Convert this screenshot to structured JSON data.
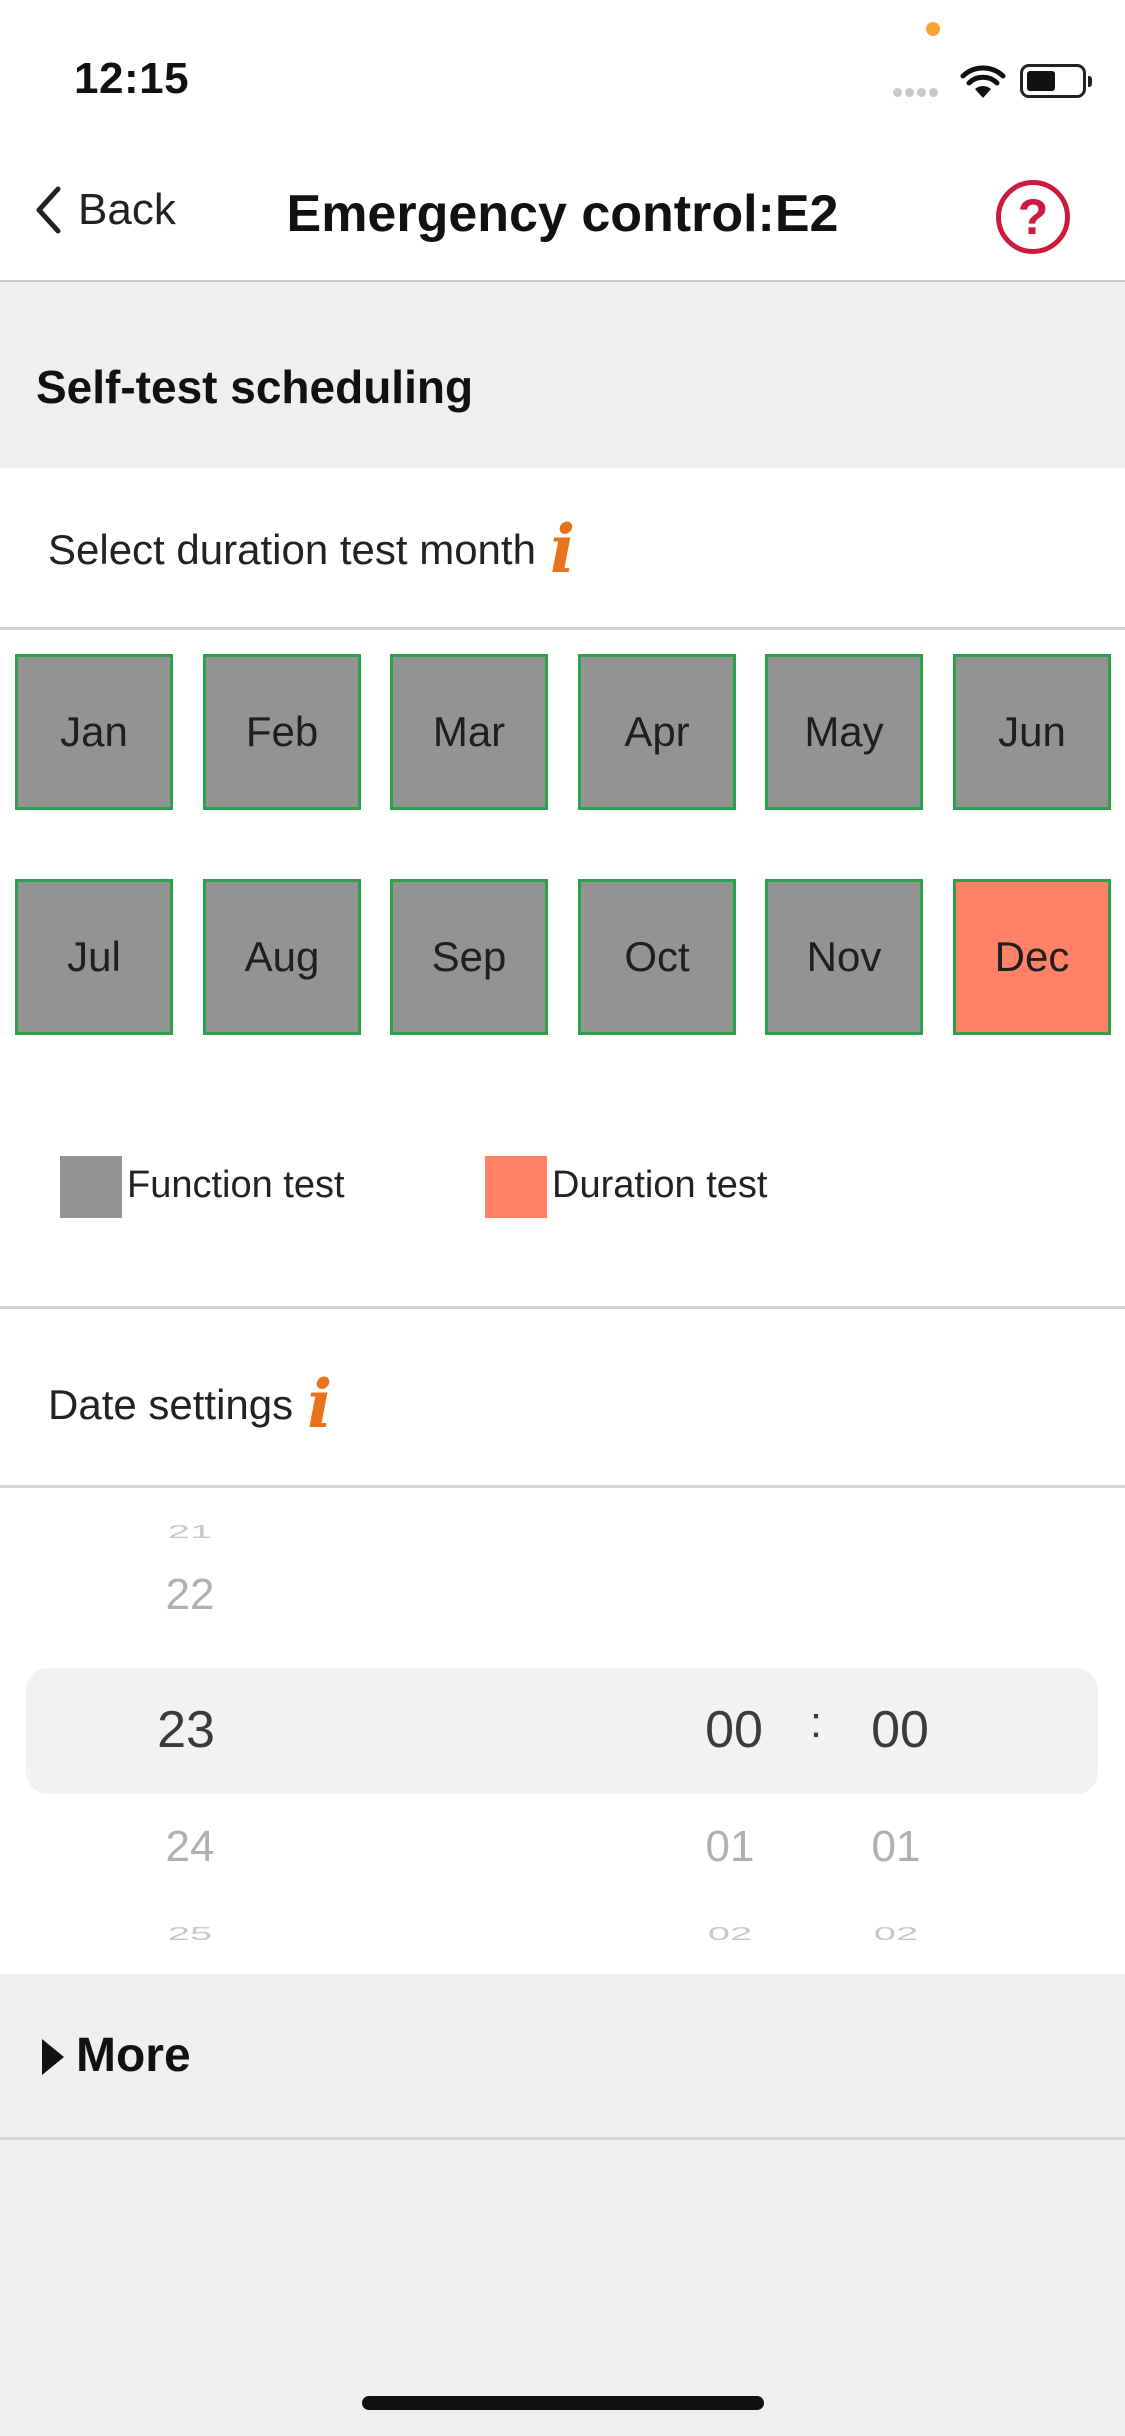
{
  "status_bar": {
    "time": "12:15"
  },
  "nav": {
    "back_label": "Back",
    "title": "Emergency control:E2",
    "help_symbol": "?"
  },
  "section": {
    "title": "Self-test scheduling"
  },
  "duration_row": {
    "label": "Select duration test month",
    "info_symbol": "i"
  },
  "months": [
    {
      "label": "Jan",
      "test": "function"
    },
    {
      "label": "Feb",
      "test": "function"
    },
    {
      "label": "Mar",
      "test": "function"
    },
    {
      "label": "Apr",
      "test": "function"
    },
    {
      "label": "May",
      "test": "function"
    },
    {
      "label": "Jun",
      "test": "function"
    },
    {
      "label": "Jul",
      "test": "function"
    },
    {
      "label": "Aug",
      "test": "function"
    },
    {
      "label": "Sep",
      "test": "function"
    },
    {
      "label": "Oct",
      "test": "function"
    },
    {
      "label": "Nov",
      "test": "function"
    },
    {
      "label": "Dec",
      "test": "duration"
    }
  ],
  "legend": {
    "function_label": "Function test",
    "duration_label": "Duration test",
    "function_color": "#939393",
    "duration_color": "#ff8267"
  },
  "date_row": {
    "label": "Date settings",
    "info_symbol": "i"
  },
  "picker": {
    "day": {
      "above2": "21",
      "above1": "22",
      "selected": "23",
      "below1": "24",
      "below2": "25"
    },
    "hour": {
      "selected": "00",
      "below1": "01",
      "below2": "02"
    },
    "separator": ":",
    "minute": {
      "selected": "00",
      "below1": "01",
      "below2": "02"
    }
  },
  "more": {
    "label": "More"
  },
  "colors": {
    "accent_red": "#cf1a3f",
    "info_orange": "#e8731a",
    "month_border": "#2da04c"
  }
}
